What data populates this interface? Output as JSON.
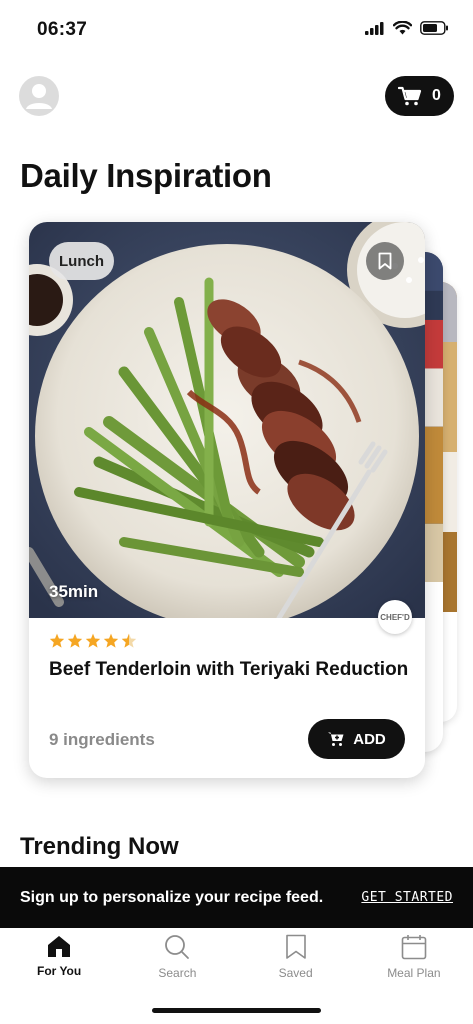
{
  "status_bar": {
    "time": "06:37"
  },
  "header": {
    "cart_count": "0"
  },
  "section": {
    "title": "Daily Inspiration"
  },
  "recipe": {
    "tag": "Lunch",
    "time": "35min",
    "brand": "CHEF'D",
    "rating": 4.5,
    "title": "Beef Tenderloin with Teriyaki Reduction",
    "ingredients": "9 ingredients",
    "add_label": "ADD"
  },
  "trending": {
    "title": "Trending Now"
  },
  "banner": {
    "text": "Sign up to personalize your recipe feed.",
    "cta": "GET STARTED"
  },
  "tabs": [
    {
      "label": "For You",
      "icon": "home-icon",
      "active": true
    },
    {
      "label": "Search",
      "icon": "search-icon",
      "active": false
    },
    {
      "label": "Saved",
      "icon": "bookmark-icon",
      "active": false
    },
    {
      "label": "Meal Plan",
      "icon": "calendar-icon",
      "active": false
    }
  ],
  "colors": {
    "star": "#f5a623",
    "dark": "#111111",
    "muted": "#8a8a8a"
  }
}
